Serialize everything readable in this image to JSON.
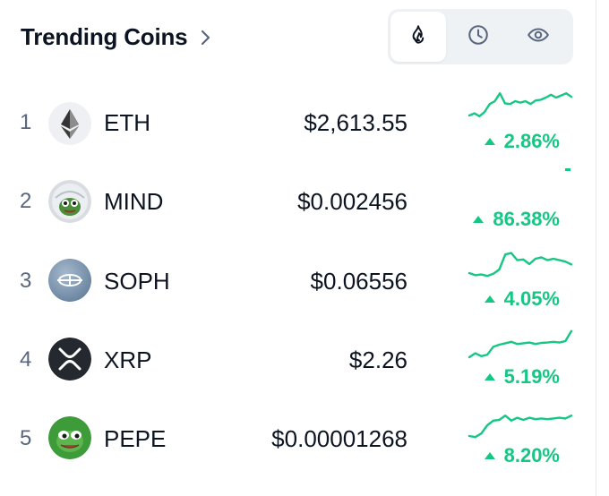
{
  "header": {
    "title": "Trending Coins",
    "tabs": [
      {
        "name": "trending",
        "icon": "fire-icon",
        "active": true
      },
      {
        "name": "recent",
        "icon": "clock-icon",
        "active": false
      },
      {
        "name": "watchlist",
        "icon": "eye-icon",
        "active": false
      }
    ]
  },
  "colors": {
    "up": "#16c784",
    "muted": "#58667e",
    "active_icon": "#0d1421",
    "segment_bg": "#eff2f5"
  },
  "coins": [
    {
      "rank": "1",
      "symbol": "ETH",
      "price": "$2,613.55",
      "change": "2.86%",
      "direction": "up",
      "logo": "ethereum-logo-icon",
      "spark": [
        0.3,
        0.36,
        0.28,
        0.4,
        0.62,
        0.7,
        0.92,
        0.64,
        0.62,
        0.7,
        0.66,
        0.7,
        0.62,
        0.72,
        0.74,
        0.8,
        0.88,
        0.8,
        0.86,
        0.92,
        0.82
      ]
    },
    {
      "rank": "2",
      "symbol": "MIND",
      "price": "$0.002456",
      "change": "86.38%",
      "direction": "up",
      "logo": "pepe-mind-logo-icon",
      "spark": [
        0.0
      ]
    },
    {
      "rank": "3",
      "symbol": "SOPH",
      "price": "$0.06556",
      "change": "4.05%",
      "direction": "up",
      "logo": "sophon-logo-icon",
      "spark": [
        0.3,
        0.24,
        0.26,
        0.22,
        0.28,
        0.4,
        0.82,
        0.86,
        0.66,
        0.68,
        0.55,
        0.7,
        0.74,
        0.66,
        0.7,
        0.66,
        0.62,
        0.54
      ]
    },
    {
      "rank": "4",
      "symbol": "XRP",
      "price": "$2.26",
      "change": "5.19%",
      "direction": "up",
      "logo": "xrp-logo-icon",
      "spark": [
        0.15,
        0.26,
        0.18,
        0.22,
        0.44,
        0.5,
        0.54,
        0.58,
        0.52,
        0.54,
        0.56,
        0.52,
        0.55,
        0.56,
        0.58,
        0.56,
        0.6,
        0.88
      ]
    },
    {
      "rank": "5",
      "symbol": "PEPE",
      "price": "$0.00001268",
      "change": "8.20%",
      "direction": "up",
      "logo": "pepe-logo-icon",
      "spark": [
        0.15,
        0.12,
        0.22,
        0.45,
        0.58,
        0.6,
        0.72,
        0.58,
        0.66,
        0.6,
        0.66,
        0.62,
        0.64,
        0.62,
        0.64,
        0.66,
        0.64,
        0.72
      ]
    }
  ]
}
